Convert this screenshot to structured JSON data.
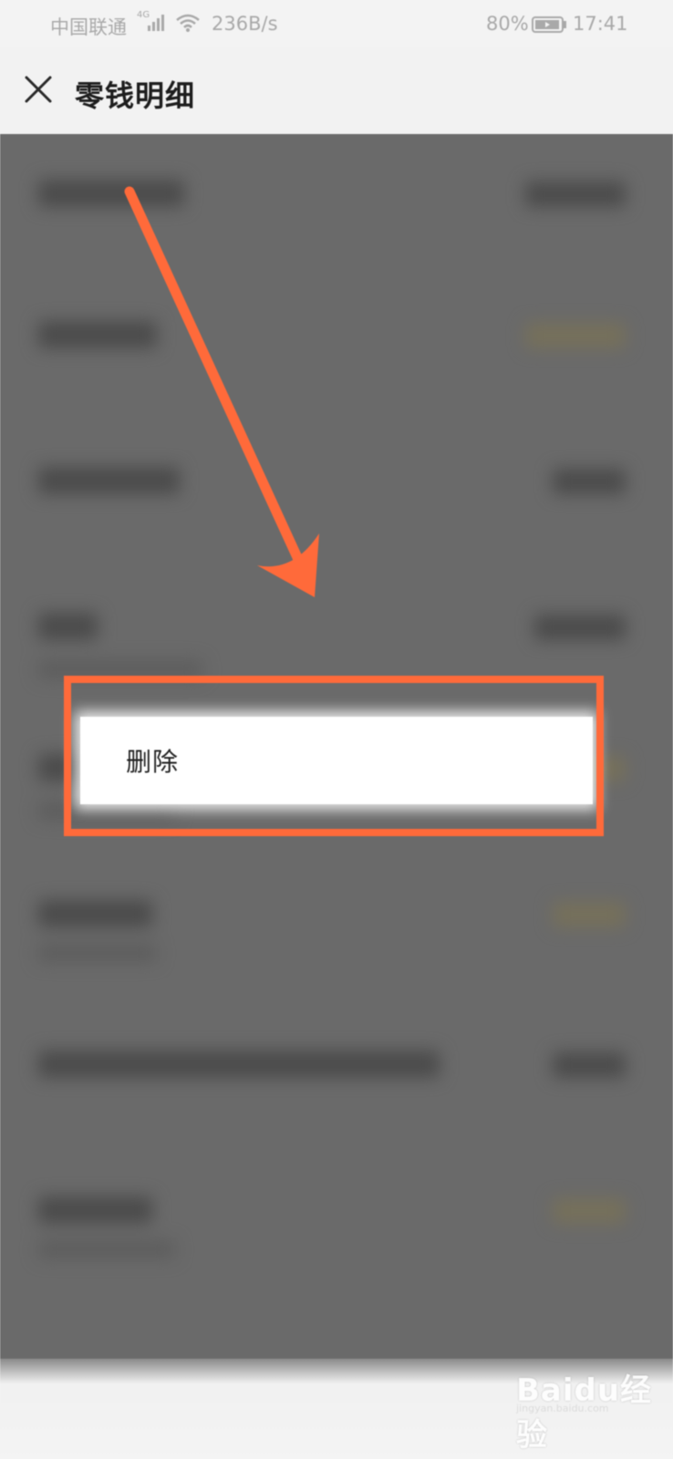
{
  "status_bar": {
    "carrier": "中国联通",
    "network": "4G",
    "speed": "236B/s",
    "battery": "80%",
    "time": "17:41"
  },
  "header": {
    "title": "零钱明细"
  },
  "context_menu": {
    "delete_label": "删除"
  },
  "colors": {
    "annotation": "#ff6a3a",
    "overlay": "#6a6a6a"
  },
  "icons": {
    "close": "close-icon",
    "signal": "signal-icon",
    "wifi": "wifi-icon",
    "battery": "battery-icon"
  },
  "watermark": {
    "logo": "Baidu经验",
    "url": "jingyan.baidu.com"
  }
}
